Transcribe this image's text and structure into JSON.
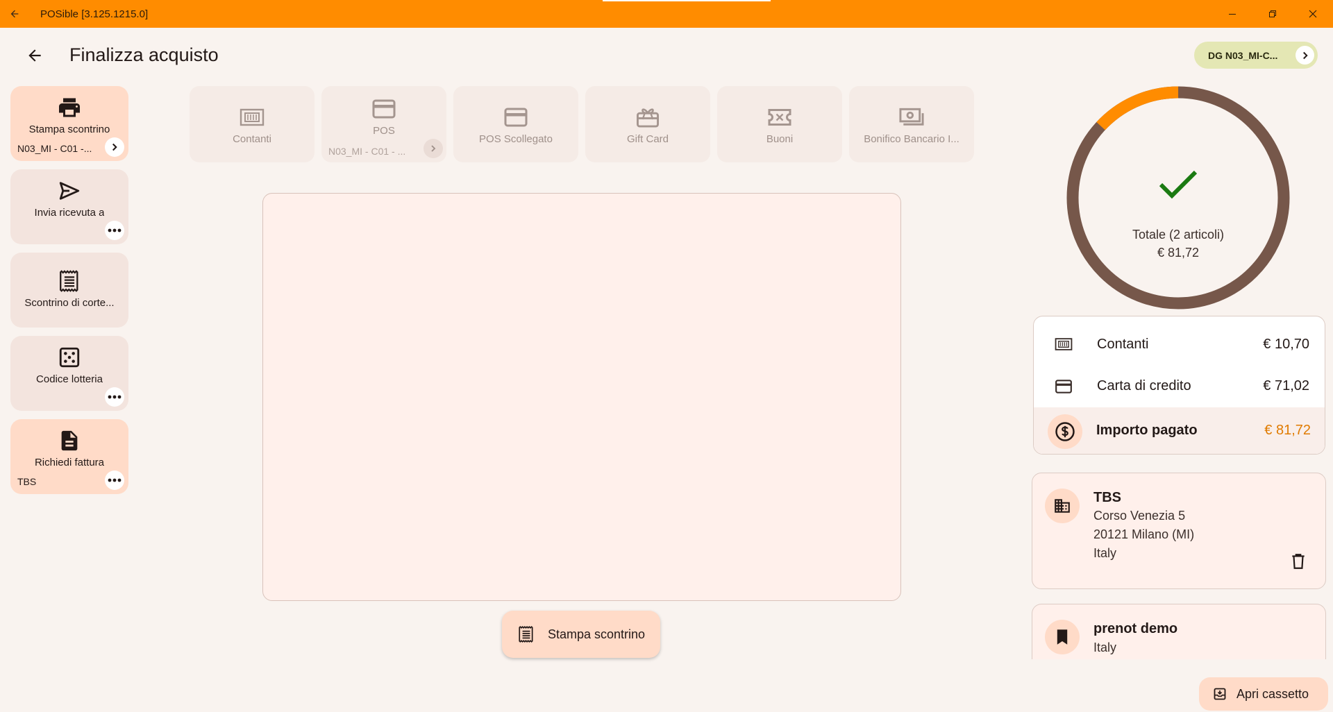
{
  "window": {
    "title": "POSible [3.125.1215.0]",
    "accent_color": "#ff8c00"
  },
  "header": {
    "title": "Finalizza acquisto",
    "device_chip": "DG N03_MI-C..."
  },
  "actions": [
    {
      "label": "Stampa scontrino",
      "sub": "N03_MI - C01 -...",
      "icon": "printer-icon",
      "badge": "chevron-right-icon"
    },
    {
      "label": "Invia ricevuta a",
      "sub": "",
      "icon": "send-icon",
      "badge": "more-icon"
    },
    {
      "label": "Scontrino di corte...",
      "sub": "",
      "icon": "receipt-icon",
      "badge": ""
    },
    {
      "label": "Codice lotteria",
      "sub": "",
      "icon": "dice-icon",
      "badge": "more-icon"
    },
    {
      "label": "Richiedi fattura",
      "sub": "TBS",
      "icon": "document-icon",
      "badge": "more-icon"
    }
  ],
  "payment_methods": [
    {
      "label": "Contanti",
      "sub": "",
      "icon": "cash-icon"
    },
    {
      "label": "POS",
      "sub": "N03_MI - C01 - ...",
      "icon": "credit-card-icon"
    },
    {
      "label": "POS Scollegato",
      "sub": "",
      "icon": "credit-card-icon"
    },
    {
      "label": "Gift Card",
      "sub": "",
      "icon": "gift-card-icon"
    },
    {
      "label": "Buoni",
      "sub": "",
      "icon": "voucher-icon"
    },
    {
      "label": "Bonifico Bancario I...",
      "sub": "",
      "icon": "bank-transfer-icon"
    }
  ],
  "print_button": "Stampa scontrino",
  "summary": {
    "total_label": "Totale (2 articoli)",
    "total_amount": "€ 81,72",
    "paid_fraction": 1.0,
    "highlight_fraction": 0.131,
    "ring_color": "#76574a",
    "highlight_color": "#ff8c00",
    "check_color": "#1b7a12"
  },
  "payments": [
    {
      "label": "Contanti",
      "amount": "€ 10,70",
      "icon": "cash-icon"
    },
    {
      "label": "Carta di credito",
      "amount": "€ 71,02",
      "icon": "credit-card-icon"
    }
  ],
  "paid": {
    "label": "Importo pagato",
    "amount": "€ 81,72"
  },
  "customer": {
    "name": "TBS",
    "address": "Corso Venezia 5",
    "city": "20121  Milano  (MI)",
    "country": "Italy"
  },
  "reservation": {
    "name": "prenot demo",
    "country": "Italy"
  },
  "drawer_button": "Apri cassetto"
}
